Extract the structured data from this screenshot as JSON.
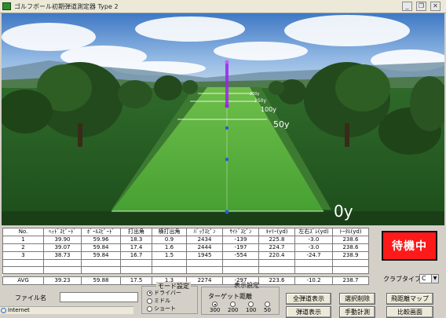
{
  "window": {
    "title": "ゴルフボール初期弾道測定器 Type 2",
    "buttons": [
      "_",
      "❐",
      "✕"
    ]
  },
  "scene": {
    "distance_markers": [
      "0y",
      "50y",
      "100y",
      "150y",
      "200y"
    ],
    "trail_color": "#a020f0",
    "point_color": "#1e5fd6"
  },
  "table": {
    "headers": [
      "No.",
      "ﾍｯﾄﾞｽﾋﾟｰﾄﾞ",
      "ﾎﾞｰﾙｽﾋﾟｰﾄﾞ",
      "打出角",
      "横打出角",
      "ﾊﾞｯｸｽﾋﾟﾝ",
      "ｻｲﾄﾞｽﾋﾟﾝ",
      "ｷｬﾘｰ(yd)",
      "左右ｽﾞﾚ(yd)",
      "ﾄｰﾀﾙ(yd)"
    ],
    "rows": [
      [
        "1",
        "39.90",
        "59.96",
        "18.3",
        "0.9",
        "2434",
        "-139",
        "225.8",
        "-3.0",
        "238.6"
      ],
      [
        "2",
        "39.07",
        "59.84",
        "17.4",
        "1.6",
        "2444",
        "-197",
        "224.7",
        "-3.0",
        "238.6"
      ],
      [
        "3",
        "38.73",
        "59.84",
        "16.7",
        "1.5",
        "1945",
        "-554",
        "220.4",
        "-24.7",
        "238.9"
      ]
    ],
    "avg": [
      "AVG",
      "39.23",
      "59.88",
      "17.5",
      "1.3",
      "2274",
      "-297",
      "223.6",
      "-10.2",
      "238.7"
    ]
  },
  "status": {
    "label": "待機中",
    "color": "#ff1a1a"
  },
  "club": {
    "label": "クラブタイプ",
    "value": "C"
  },
  "file": {
    "label": "ファイル名",
    "value": ""
  },
  "mode": {
    "legend": "モード設定",
    "options": [
      "ドライバー",
      "ミドル",
      "ショート"
    ],
    "selected": "ドライバー"
  },
  "display": {
    "legend": "表示設定",
    "target_label": "ターゲット距離",
    "targets": [
      "300",
      "200",
      "100",
      "50"
    ],
    "target_selected": "300",
    "btn_all": "全弾道表示",
    "btn_multi": "弾道表示"
  },
  "actions": {
    "delete": "選択削除",
    "distance_map": "飛距離マップ",
    "manual": "手動計測",
    "compare": "比較画面"
  },
  "statusbar": {
    "text": "Internet"
  }
}
